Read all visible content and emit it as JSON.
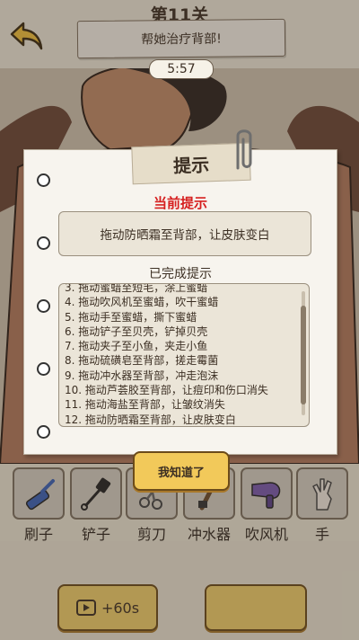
{
  "header": {
    "level": "第11关",
    "task": "帮她治疗背部!",
    "timer": "5:57"
  },
  "hint_dialog": {
    "title": "提示",
    "current_label": "当前提示",
    "current_hint": "拖动防晒霜至背部，让皮肤变白",
    "completed_label": "已完成提示",
    "completed": [
      "3. 拖动蜜蜡至短毛，涂上蜜蜡",
      "4. 拖动吹风机至蜜蜡，吹干蜜蜡",
      "5. 拖动手至蜜蜡，撕下蜜蜡",
      "6. 拖动铲子至贝壳，铲掉贝壳",
      "7. 拖动夹子至小鱼，夹走小鱼",
      "8. 拖动硫磺皂至背部，搓走霉菌",
      "9. 拖动冲水器至背部，冲走泡沫",
      "10. 拖动芦荟胶至背部，让痘印和伤口消失",
      "11. 拖动海盐至背部，让皱纹消失",
      "12. 拖动防晒霜至背部，让皮肤变白"
    ],
    "ok_label": "我知道了"
  },
  "tools": [
    {
      "label": "刷子",
      "icon": "brush-icon"
    },
    {
      "label": "铲子",
      "icon": "shovel-icon"
    },
    {
      "label": "剪刀",
      "icon": "scissors-icon"
    },
    {
      "label": "冲水器",
      "icon": "water-gun-icon"
    },
    {
      "label": "吹风机",
      "icon": "hair-dryer-icon"
    },
    {
      "label": "手",
      "icon": "hand-icon"
    }
  ],
  "bottom": {
    "add_time_label": "+60s"
  },
  "colors": {
    "accent_button": "#f2cf6a",
    "current_hint_red": "#d62020",
    "paper": "#f7f4ee"
  }
}
